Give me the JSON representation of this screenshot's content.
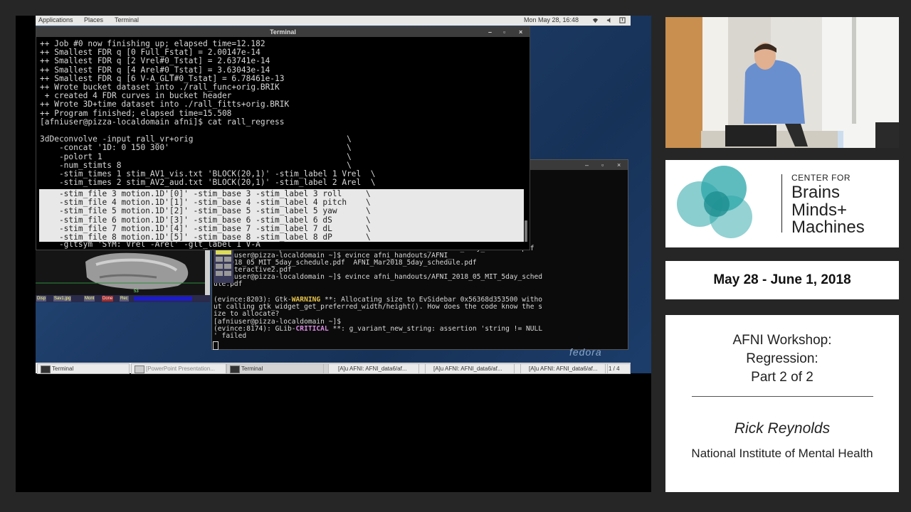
{
  "topbar": {
    "applications": "Applications",
    "places": "Places",
    "terminal": "Terminal",
    "datetime": "Mon May 28, 16:48"
  },
  "term1": {
    "title": "Terminal",
    "lines": [
      "++ Job #0 now finishing up; elapsed time=12.182",
      "++ Smallest FDR q [0 Full_Fstat] = 2.00147e-14",
      "++ Smallest FDR q [2 Vrel#0_Tstat] = 2.63741e-14",
      "++ Smallest FDR q [4 Arel#0_Tstat] = 3.63043e-14",
      "++ Smallest FDR q [6 V-A_GLT#0_Tstat] = 6.78461e-13",
      "++ Wrote bucket dataset into ./rall_func+orig.BRIK",
      " + created 4 FDR curves in bucket header",
      "++ Wrote 3D+time dataset into ./rall_fitts+orig.BRIK",
      "++ Program finished; elapsed time=15.508",
      "[afniuser@pizza-localdomain afni]$ cat rall_regress",
      "",
      "3dDeconvolve -input rall_vr+orig                                \\",
      "    -concat '1D: 0 150 300'                                     \\",
      "    -polort 1                                                   \\",
      "    -num_stimts 8                                               \\",
      "    -stim_times 1 stim_AV1_vis.txt 'BLOCK(20,1)' -stim_label 1 Vrel  \\",
      "    -stim_times 2 stim_AV2_aud.txt 'BLOCK(20,1)' -stim_label 2 Arel  \\"
    ],
    "highlight_lines": [
      "    -stim_file 3 motion.1D'[0]' -stim_base 3 -stim_label 3 roll     \\",
      "    -stim_file 4 motion.1D'[1]' -stim_base 4 -stim_label 4 pitch    \\",
      "    -stim_file 5 motion.1D'[2]' -stim_base 5 -stim_label 5 yaw      \\",
      "    -stim_file 6 motion.1D'[3]' -stim_base 6 -stim_label 6 dS       \\",
      "    -stim_file 7 motion.1D'[4]' -stim_base 7 -stim_label 7 dL       \\",
      "    -stim_file 8 motion.1D'[5]' -stim_base 8 -stim_label 8 dP       \\"
    ],
    "last_line": "    -gltsym 'SYM: Vrel -Arel' -glt_label 1 V-A"
  },
  "term2": {
    "line1": "  _interactive2.pdf                             AFNI_Mar2018_5day_schedule.pdf",
    "line2": "[afniuser@pizza-localdomain ~]$ evince afni_handouts/AFNI_",
    "line3": "  _2018_05_MIT_5day_schedule.pdf  AFNI_Mar2018_5day_schedule.pdf",
    "line4": "  _interactive2.pdf",
    "line5": "[afniuser@pizza-localdomain ~]$ evince afni_handouts/AFNI_2018_05_MIT_5day_sched",
    "line6": "ule.pdf",
    "line7_pre": "(evince:8203): Gtk-",
    "line7_warn": "WARNING",
    "line7_post": " **: Allocating size to EvSidebar 0x56368d353500 witho",
    "line8": "ut calling gtk_widget_get_preferred_width/height(). How does the code know the s",
    "line9": "ize to allocate?",
    "line10": "[afniuser@pizza-localdomain ~]$",
    "line11_pre": "(evince:8174): GLib-",
    "line11_crit": "CRITICAL",
    "line11_post": " **: g_variant_new_string: assertion 'string != NULL",
    "line12": "' failed"
  },
  "afni": {
    "buttons": [
      "Disp",
      "Sav1.jpg",
      "Mont",
      "Done",
      "Rec"
    ],
    "slice_number": "53"
  },
  "fedora_label": "fedora",
  "taskbar": {
    "items": [
      "Terminal",
      "[PowerPoint Presentation...",
      "Terminal",
      "[A]u AFNI: AFNI_data6/af...",
      "[A]u AFNI: AFNI_data6/af...",
      "[A]u AFNI: AFNI_data6/af..."
    ],
    "workspace": "1 / 4"
  },
  "logo": {
    "line1": "CENTER FOR",
    "line2": "Brains",
    "line3": "Minds+",
    "line4": "Machines"
  },
  "event": {
    "dates": "May 28 - June 1, 2018",
    "title_line1": "AFNI Workshop:",
    "title_line2": "Regression:",
    "title_line3": "Part 2 of 2",
    "speaker": "Rick Reynolds",
    "affiliation": "National Institute of Mental Health"
  },
  "colors": {
    "cbmm_teal": "#2aa6a8",
    "warning": "#e5c34b",
    "critical": "#d88be0",
    "desktop_blue": "#1f3f66"
  }
}
